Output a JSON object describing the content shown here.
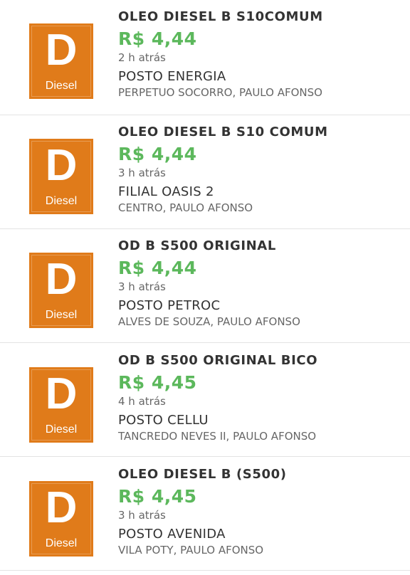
{
  "badge": {
    "letter": "D",
    "word": "Diesel",
    "color": "#e07b1a"
  },
  "colors": {
    "price": "#5cb85c",
    "divider": "#e3e3e3"
  },
  "items": [
    {
      "product": "OLEO DIESEL B S10COMUM",
      "price": "R$ 4,44",
      "time": "2 h atrás",
      "station": "POSTO ENERGIA",
      "address": "PERPETUO SOCORRO, PAULO AFONSO"
    },
    {
      "product": "OLEO DIESEL B S10 COMUM",
      "price": "R$ 4,44",
      "time": "3 h atrás",
      "station": "FILIAL OASIS 2",
      "address": "CENTRO, PAULO AFONSO"
    },
    {
      "product": "OD B S500 ORIGINAL",
      "price": "R$ 4,44",
      "time": "3 h atrás",
      "station": "POSTO PETROC",
      "address": "ALVES DE SOUZA, PAULO AFONSO"
    },
    {
      "product": "OD B S500 ORIGINAL BICO",
      "price": "R$ 4,45",
      "time": "4 h atrás",
      "station": "POSTO CELLU",
      "address": "TANCREDO NEVES II, PAULO AFONSO"
    },
    {
      "product": "OLEO DIESEL B (S500)",
      "price": "R$ 4,45",
      "time": "3 h atrás",
      "station": "POSTO AVENIDA",
      "address": "VILA POTY, PAULO AFONSO"
    }
  ]
}
